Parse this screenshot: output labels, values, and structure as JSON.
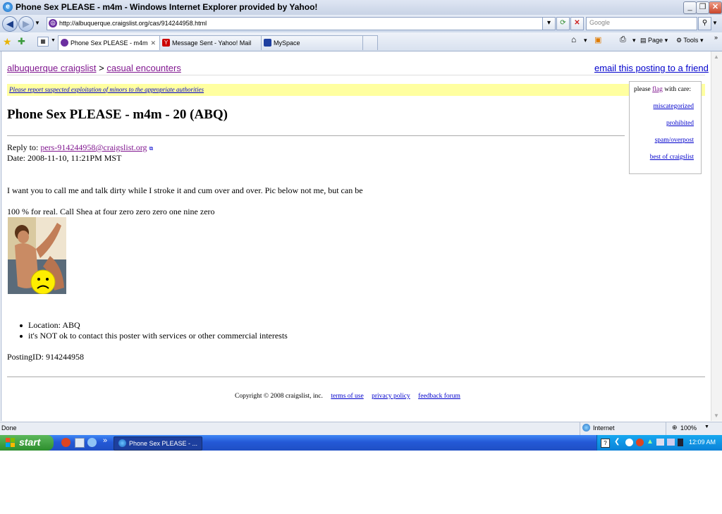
{
  "window": {
    "title": "Phone Sex PLEASE - m4m - Windows Internet Explorer provided by Yahoo!"
  },
  "address": {
    "url": "http://albuquerque.craigslist.org/cas/914244958.html",
    "search_placeholder": "Google"
  },
  "tabs": [
    {
      "label": "Phone Sex PLEASE - m4m",
      "active": true
    },
    {
      "label": "Message Sent - Yahoo! Mail",
      "active": false
    },
    {
      "label": "MySpace",
      "active": false
    }
  ],
  "toolbar": {
    "page_label": "Page",
    "tools_label": "Tools"
  },
  "page": {
    "breadcrumb": {
      "site": "albuquerque craigslist",
      "sep": ">",
      "section": "casual encounters"
    },
    "email_friend": "email this posting to a friend",
    "warning": "Please report suspected exploitation of minors to the appropriate authorities",
    "flag": {
      "prefix": "please",
      "flag_word": "flag",
      "suffix": "with care:",
      "items": [
        "miscategorized",
        "prohibited",
        "spam/overpost",
        "best of craigslist"
      ]
    },
    "title": "Phone Sex PLEASE - m4m - 20 (ABQ)",
    "reply_label": "Reply to:",
    "reply_email": "pers-914244958@craigslist.org",
    "date_line": "Date: 2008-11-10, 11:21PM MST",
    "body_line1": "I want you to call me and talk dirty while I stroke it and cum over and over. Pic below not me, but can be",
    "body_line2": "100 % for real. Call Shea at four zero zero zero one nine zero",
    "bullets": [
      "Location: ABQ",
      "it's NOT ok to contact this poster with services or other commercial interests"
    ],
    "posting_id": "PostingID: 914244958",
    "footer": {
      "copyright": "Copyright © 2008 craigslist, inc.",
      "links": [
        "terms of use",
        "privacy policy",
        "feedback forum"
      ]
    }
  },
  "status": {
    "text": "Done",
    "zone": "Internet",
    "zoom": "100%"
  },
  "taskbar": {
    "start": "start",
    "task": "Phone Sex PLEASE - ...",
    "clock": "12:09 AM"
  },
  "colors": {
    "visited_link": "#80168f",
    "link": "#0000cc",
    "warning_bg": "#ffffa0"
  }
}
